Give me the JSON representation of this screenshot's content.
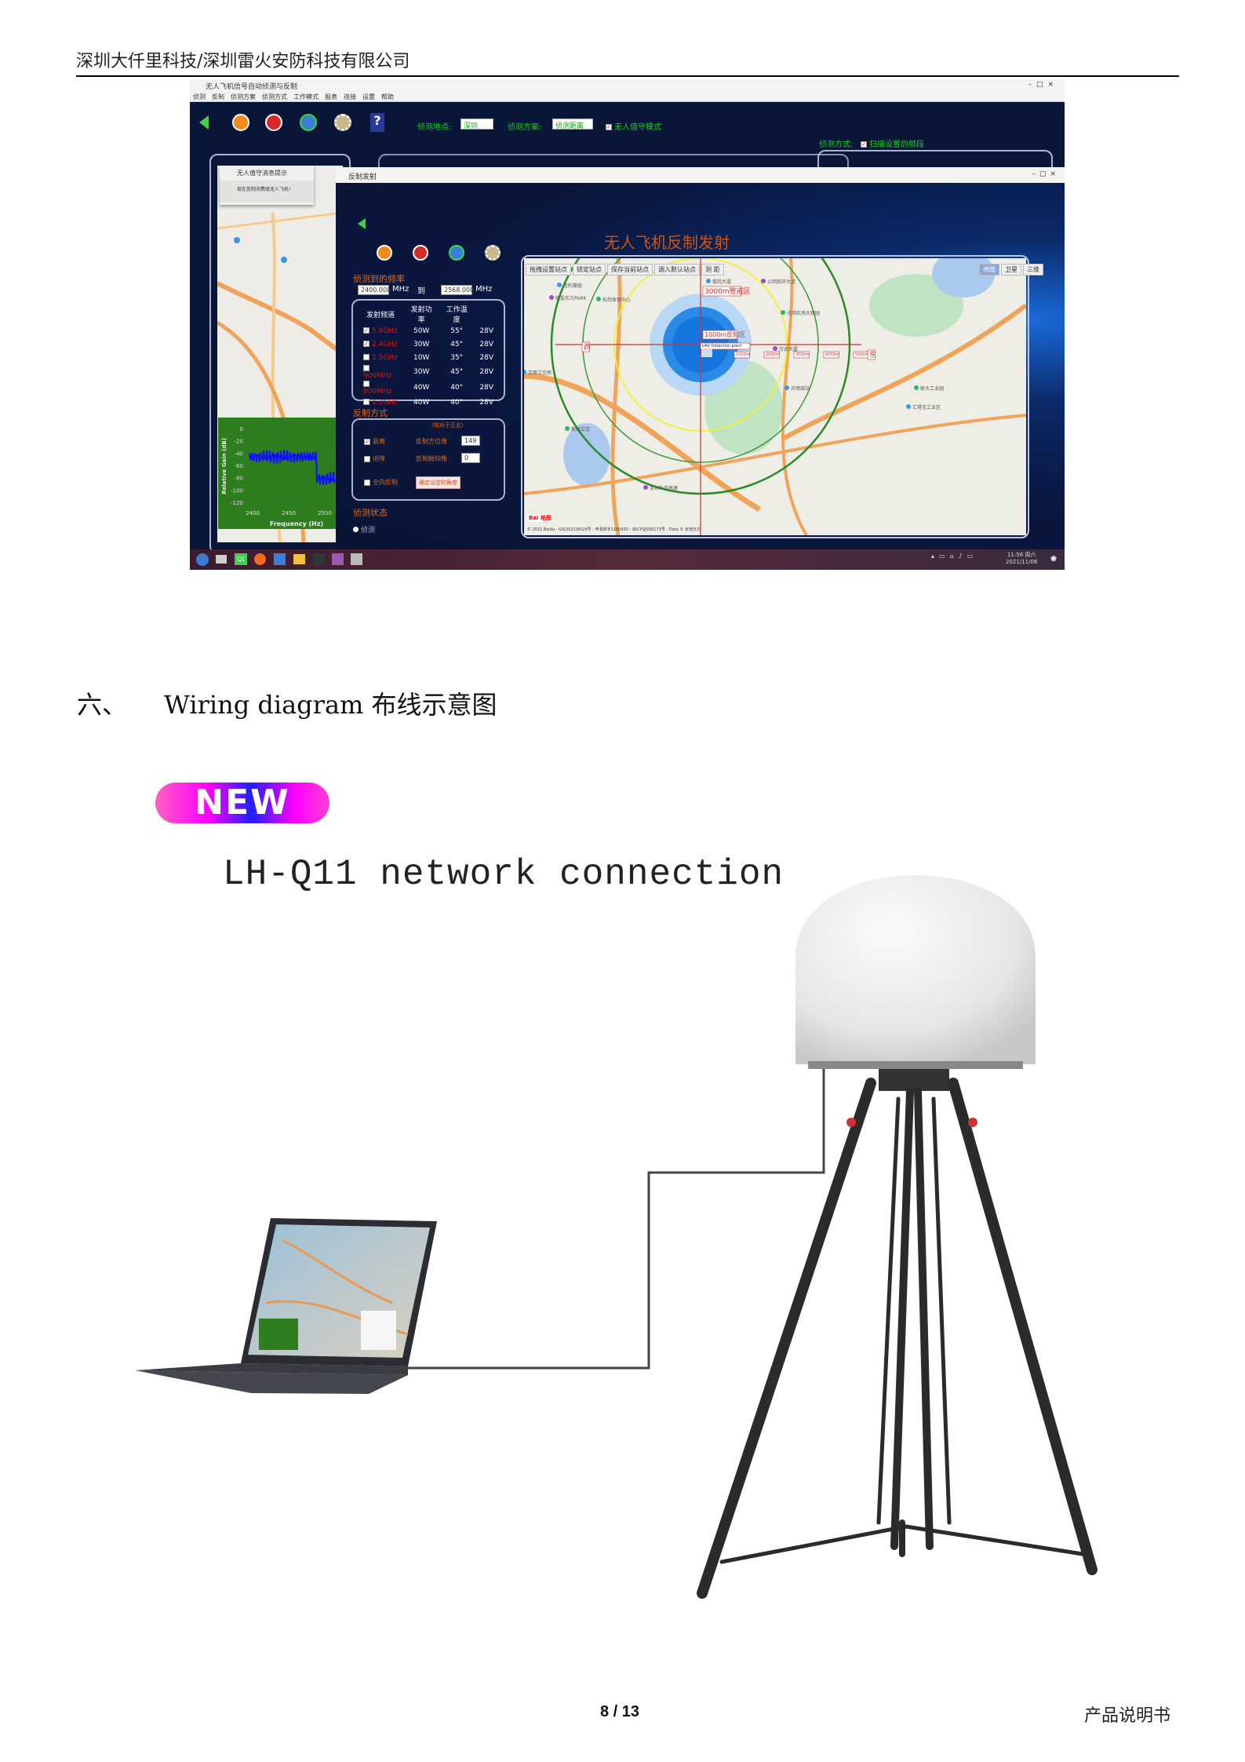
{
  "header": {
    "company": "深圳大仟里科技/深圳雷火安防科技有限公司"
  },
  "app": {
    "title": "无人飞机信号自动侦测与反制",
    "window_controls": [
      "–",
      "□",
      "×"
    ],
    "menu": [
      "侦测",
      "反制",
      "侦测方案",
      "侦测方式",
      "工作模式",
      "报表",
      "连接",
      "设置",
      "帮助"
    ],
    "toolbar": {
      "location_label": "侦测地点:",
      "location_value": "深圳",
      "scheme_label": "侦测方案:",
      "scheme_value": "侦测距离",
      "unattended_label": "无人值守模式",
      "unattended_checked": true,
      "detect_mode_label": "侦测方式:",
      "detect_mode_value": "扫描设置的频段"
    },
    "popup": {
      "title": "无人值守消息提示",
      "message": "现在反制消费级无人飞机!"
    },
    "spectrum": {
      "ylabel": "Relative Gain (dB)",
      "xlabel": "Frequency (Hz)",
      "yticks": [
        "0",
        "-20",
        "-40",
        "-60",
        "-80",
        "-100",
        "-120"
      ],
      "xticks": [
        "2400",
        "2450",
        "2500"
      ],
      "bg": "#2e7d1e",
      "line": "#1010ff"
    },
    "counter_window": {
      "title": "反制发射",
      "heading": "无人飞机反制发射",
      "freq_label": "侦测到的频率",
      "freq_from": "2400.000",
      "freq_to": "2568.000",
      "unit": "MHz",
      "to": "到",
      "table_headers": [
        "发射频道",
        "发射功率",
        "工作温度"
      ],
      "channels": [
        {
          "band": "5.8GHz",
          "power": "50W",
          "temp": "55°",
          "voltage": "28V",
          "checked": true
        },
        {
          "band": "2.4GHz",
          "power": "30W",
          "temp": "45°",
          "voltage": "28V",
          "checked": true
        },
        {
          "band": "1.5GHz",
          "power": "10W",
          "temp": "35°",
          "voltage": "28V",
          "checked": false
        },
        {
          "band": "900MHz",
          "power": "30W",
          "temp": "45°",
          "voltage": "28V",
          "checked": false
        },
        {
          "band": "800MHz",
          "power": "40W",
          "temp": "40°",
          "voltage": "28V",
          "checked": false
        },
        {
          "band": "1.2GHz",
          "power": "40W",
          "temp": "40°",
          "voltage": "28V",
          "checked": false
        }
      ],
      "mode_label": "反制方式",
      "mode_note": "(相对于正北)",
      "modes": [
        {
          "label": "驱离",
          "checked": true
        },
        {
          "label": "迫降",
          "checked": false
        },
        {
          "label": "全向反制",
          "checked": false
        }
      ],
      "azimuth_label": "反制方位角",
      "azimuth_value": "149",
      "elevation_label": "反制俯仰角",
      "elevation_value": "0",
      "confirm_button": "确定设定的角度",
      "status_label": "侦测状态",
      "status_radio": "侦测"
    },
    "map": {
      "toolbar": [
        "拖拽设置站点",
        "锁定站点",
        "保存当前站点",
        "调入默认站点",
        "测 距"
      ],
      "types": [
        "地图",
        "卫星",
        "三维"
      ],
      "warning_zone": "3000m警戒区",
      "counter_zone": "1000m反制区",
      "detection_point": "UAV Detection point",
      "east": "东",
      "west": "西",
      "rings": [
        "1000m",
        "2000m",
        "3000m",
        "4000m",
        "5000m"
      ],
      "places": [
        "宝利豪庭",
        "联投东方PARK",
        "松岗体育中心",
        "楼岗大道",
        "公明南环大道",
        "光明农场大观园",
        "光明城站",
        "万润大厦",
        "联大工业园",
        "汇得宝工业区",
        "深圳外环高速",
        "新桥立交",
        "芙蓉立交桥"
      ],
      "copyright": "© 2021 Baidu - GS(2021)6026号 - 甲测资字1100930 - 京ICP证030173号 - Data © 长地万方",
      "logo": "Bai 地图"
    },
    "taskbar": {
      "time": "11:56 周六",
      "date": "2021/11/06"
    }
  },
  "section": {
    "number": "六、",
    "title": "Wiring diagram 布线示意图"
  },
  "badge": {
    "label": "NEW"
  },
  "diagram": {
    "caption": "LH-Q11 network connection"
  },
  "footer": {
    "page": "8 / 13",
    "doc": "产品说明书"
  }
}
